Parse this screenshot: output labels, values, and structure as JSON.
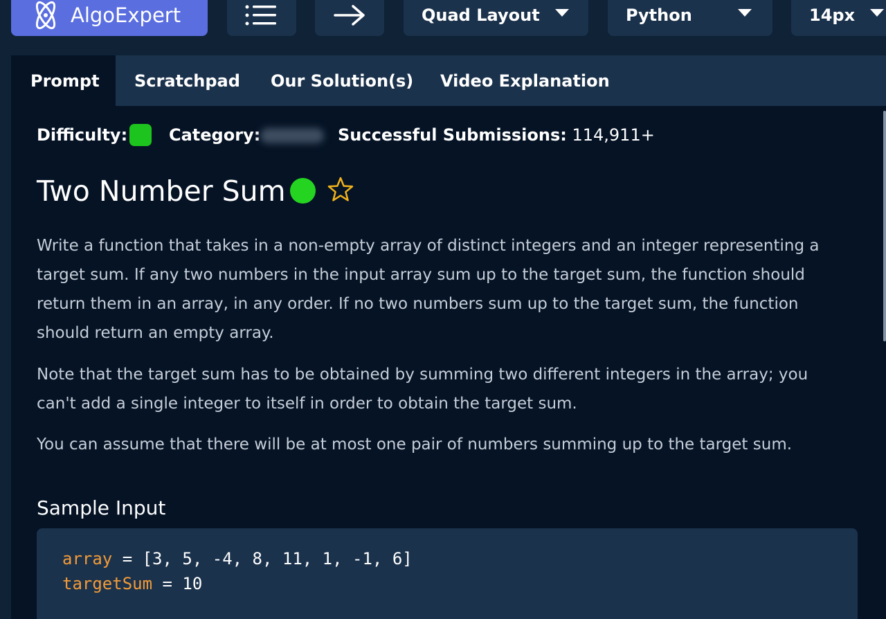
{
  "topbar": {
    "logo_text": "AlgoExpert",
    "menu_icon": "list-icon",
    "next_icon": "arrow-right-icon",
    "layout_label": "Quad Layout",
    "language_label": "Python",
    "font_size_label": "14px"
  },
  "tabs": [
    {
      "label": "Prompt",
      "active": true
    },
    {
      "label": "Scratchpad",
      "active": false
    },
    {
      "label": "Our Solution(s)",
      "active": false
    },
    {
      "label": "Video Explanation",
      "active": false
    }
  ],
  "meta": {
    "difficulty_label": "Difficulty:",
    "category_label": "Category:",
    "submissions_label": "Successful Submissions:",
    "submissions_value": "114,911+"
  },
  "question": {
    "title": "Two Number Sum",
    "paragraphs": [
      "Write a function that takes in a non-empty array of distinct integers and an integer representing a target sum. If any two numbers in the input array sum up to the target sum, the function should return them in an array, in any order. If no two numbers sum up to the target sum, the function should return an empty array.",
      "Note that the target sum has to be obtained by summing two different integers in the array; you can't add a single integer to itself in order to obtain the target sum.",
      "You can assume that there will be at most one pair of numbers summing up to the target sum."
    ],
    "sample_input_title": "Sample Input",
    "code": [
      {
        "var": "array",
        "rest": " = [3, 5, -4, 8, 11, 1, -1, 6]"
      },
      {
        "var": "targetSum",
        "rest": " = 10"
      }
    ]
  },
  "colors": {
    "background": "#0f2236",
    "panel": "#051325",
    "accent": "#5a6ee0",
    "difficulty_easy": "#1ec41e",
    "code_variable": "#f29b38"
  }
}
